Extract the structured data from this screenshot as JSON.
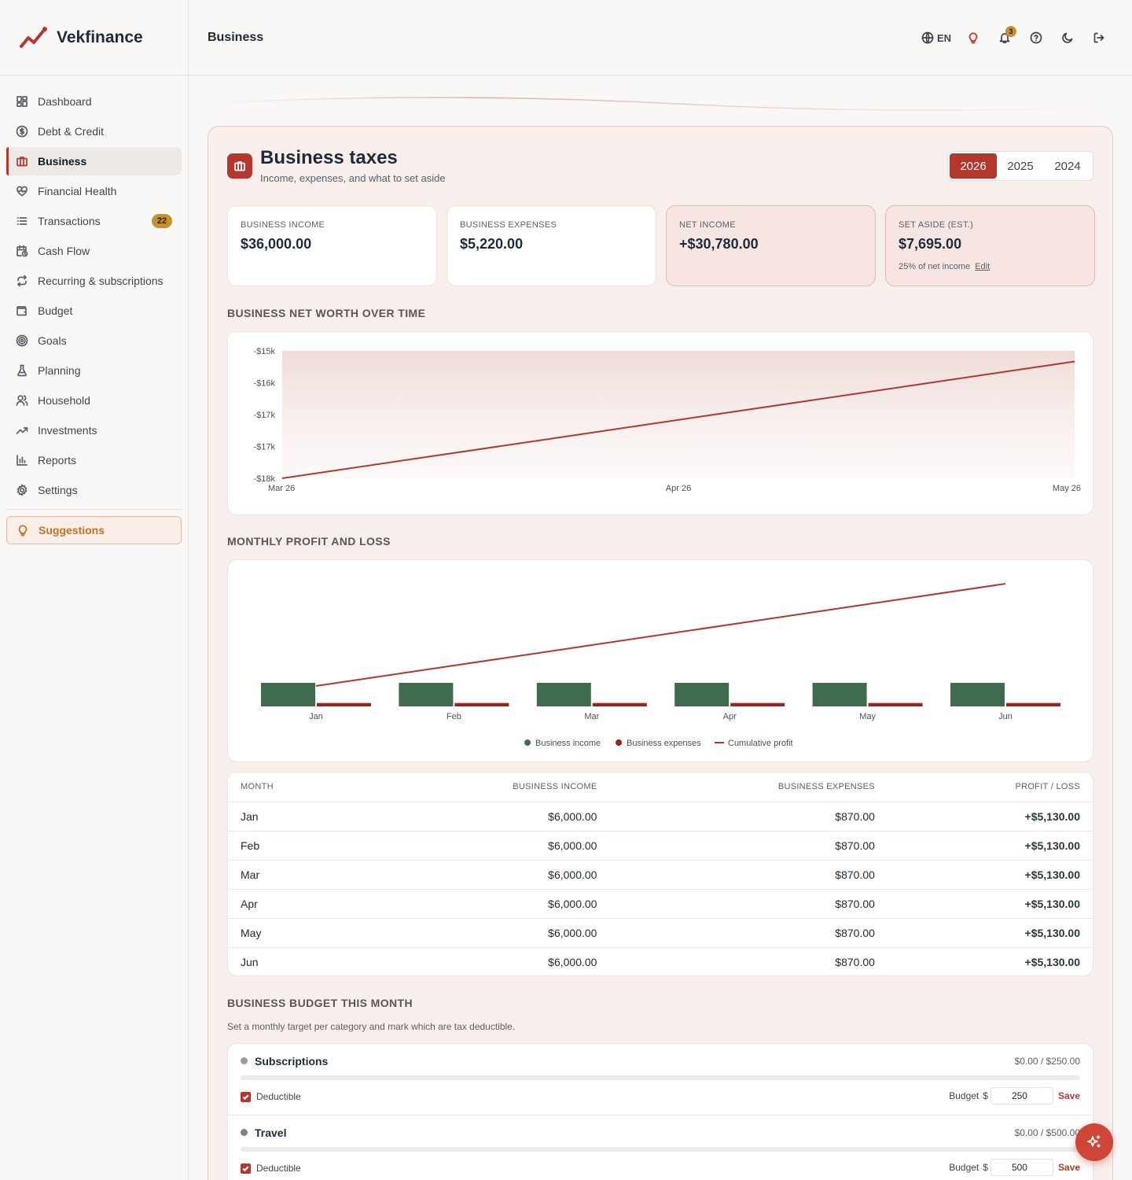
{
  "app": {
    "name": "Vekfinance"
  },
  "header": {
    "title": "Business",
    "lang": "EN",
    "notification_count": "3"
  },
  "sidebar": {
    "items": [
      {
        "label": "Dashboard",
        "icon": "dashboard-icon"
      },
      {
        "label": "Debt & Credit",
        "icon": "dollar-circle-icon"
      },
      {
        "label": "Business",
        "icon": "briefcase-icon",
        "active": true
      },
      {
        "label": "Financial Health",
        "icon": "heart-pulse-icon"
      },
      {
        "label": "Transactions",
        "icon": "list-icon",
        "badge": "22"
      },
      {
        "label": "Cash Flow",
        "icon": "calendar-clock-icon"
      },
      {
        "label": "Recurring & subscriptions",
        "icon": "repeat-icon"
      },
      {
        "label": "Budget",
        "icon": "wallet-icon"
      },
      {
        "label": "Goals",
        "icon": "target-icon"
      },
      {
        "label": "Planning",
        "icon": "flask-icon"
      },
      {
        "label": "Household",
        "icon": "users-icon"
      },
      {
        "label": "Investments",
        "icon": "trending-up-icon"
      },
      {
        "label": "Reports",
        "icon": "bar-chart-icon"
      },
      {
        "label": "Settings",
        "icon": "gear-icon"
      }
    ],
    "suggestions_label": "Suggestions"
  },
  "panel": {
    "title": "Business taxes",
    "subtitle": "Income, expenses, and what to set aside",
    "years": [
      "2026",
      "2025",
      "2024"
    ],
    "active_year": "2026"
  },
  "cards": [
    {
      "label": "BUSINESS INCOME",
      "value": "$36,000.00"
    },
    {
      "label": "BUSINESS EXPENSES",
      "value": "$5,220.00"
    },
    {
      "label": "NET INCOME",
      "value": "+$30,780.00"
    },
    {
      "label": "SET ASIDE (EST.)",
      "value": "$7,695.00",
      "note": "25% of net income",
      "edit": "Edit"
    }
  ],
  "sections": {
    "net_worth": "BUSINESS NET WORTH OVER TIME",
    "pnl": "MONTHLY PROFIT AND LOSS",
    "budget": "BUSINESS BUDGET THIS MONTH",
    "budget_desc": "Set a monthly target per category and mark which are tax deductible."
  },
  "chart_data": [
    {
      "type": "area",
      "title": "BUSINESS NET WORTH OVER TIME",
      "x": [
        "Mar 26",
        "Apr 26",
        "May 26"
      ],
      "y_ticks": [
        "-$15k",
        "-$16k",
        "-$17k",
        "-$17k",
        "-$18k"
      ],
      "ylim": [
        -18000,
        -15000
      ],
      "series": [
        {
          "x": [
            "Mar 26",
            "May 26"
          ],
          "values": [
            -18000,
            -15250
          ]
        }
      ],
      "color": "#b3372d",
      "grid": false
    },
    {
      "type": "bar",
      "title": "MONTHLY PROFIT AND LOSS",
      "categories": [
        "Jan",
        "Feb",
        "Mar",
        "Apr",
        "May",
        "Jun"
      ],
      "series": [
        {
          "name": "Business income",
          "values": [
            6000,
            6000,
            6000,
            6000,
            6000,
            6000
          ],
          "color": "#3f6b4f"
        },
        {
          "name": "Business expenses",
          "values": [
            870,
            870,
            870,
            870,
            870,
            870
          ],
          "color": "#9b2420"
        },
        {
          "name": "Cumulative profit",
          "type": "line",
          "values": [
            5130,
            10260,
            15390,
            20520,
            25650,
            30780
          ],
          "color": "#b3372d"
        }
      ],
      "legend": "bottom-center",
      "grid": false
    }
  ],
  "table": {
    "headers": [
      "MONTH",
      "BUSINESS INCOME",
      "BUSINESS EXPENSES",
      "PROFIT / LOSS"
    ],
    "rows": [
      [
        "Jan",
        "$6,000.00",
        "$870.00",
        "+$5,130.00"
      ],
      [
        "Feb",
        "$6,000.00",
        "$870.00",
        "+$5,130.00"
      ],
      [
        "Mar",
        "$6,000.00",
        "$870.00",
        "+$5,130.00"
      ],
      [
        "Apr",
        "$6,000.00",
        "$870.00",
        "+$5,130.00"
      ],
      [
        "May",
        "$6,000.00",
        "$870.00",
        "+$5,130.00"
      ],
      [
        "Jun",
        "$6,000.00",
        "$870.00",
        "+$5,130.00"
      ]
    ]
  },
  "budget": {
    "categories": [
      {
        "name": "Subscriptions",
        "dot_color": "#9a9a9a",
        "amount": "$0.00 / $250.00",
        "spent_fraction": 0,
        "deductible_label": "Deductible",
        "budget_label": "Budget",
        "currency": "$",
        "budget_value": "250",
        "save": "Save"
      },
      {
        "name": "Travel",
        "dot_color": "#77828a",
        "amount": "$0.00 / $500.00",
        "spent_fraction": 0,
        "deductible_label": "Deductible",
        "budget_label": "Budget",
        "currency": "$",
        "budget_value": "500",
        "save": "Save"
      }
    ]
  }
}
